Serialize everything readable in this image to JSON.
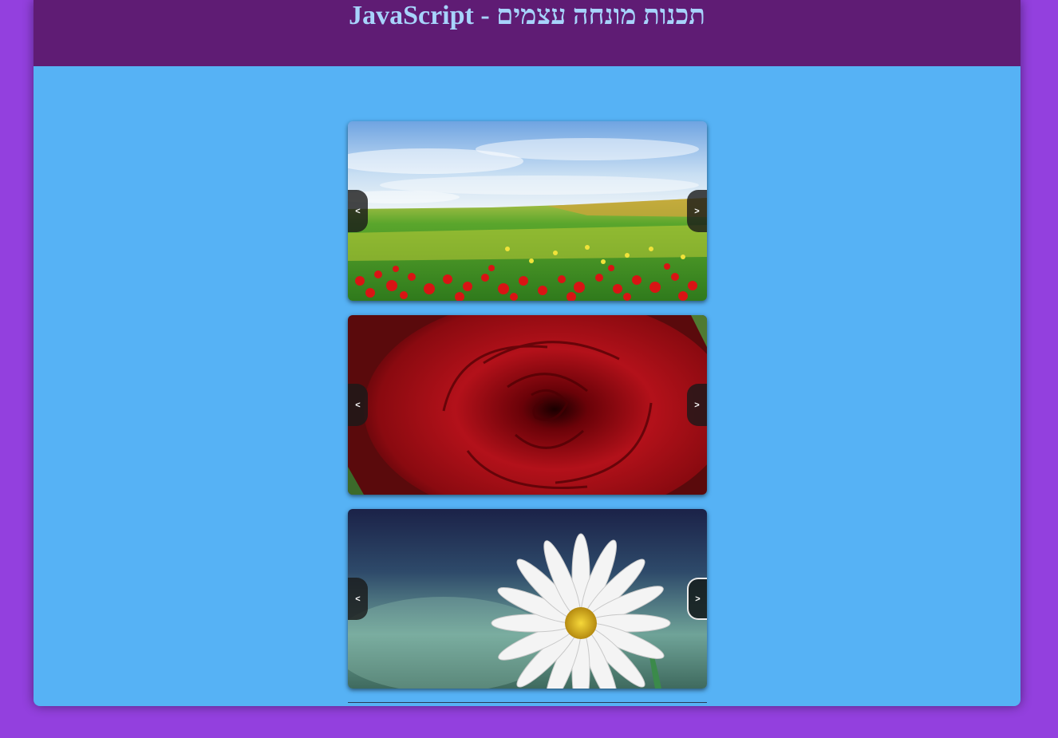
{
  "header": {
    "title": "JavaScript - תכנות מונחה עצמים"
  },
  "sliders": [
    {
      "image": "poppy-field-image",
      "prev_label": "<",
      "next_label": ">"
    },
    {
      "image": "red-rose-image",
      "prev_label": "<",
      "next_label": ">"
    },
    {
      "image": "white-daisy-image",
      "prev_label": "<",
      "next_label": ">"
    }
  ],
  "colors": {
    "page_background": "#9340de",
    "content_background": "#56b2f5",
    "header_background": "#5f1c74",
    "title_color": "#a7d3fb"
  }
}
